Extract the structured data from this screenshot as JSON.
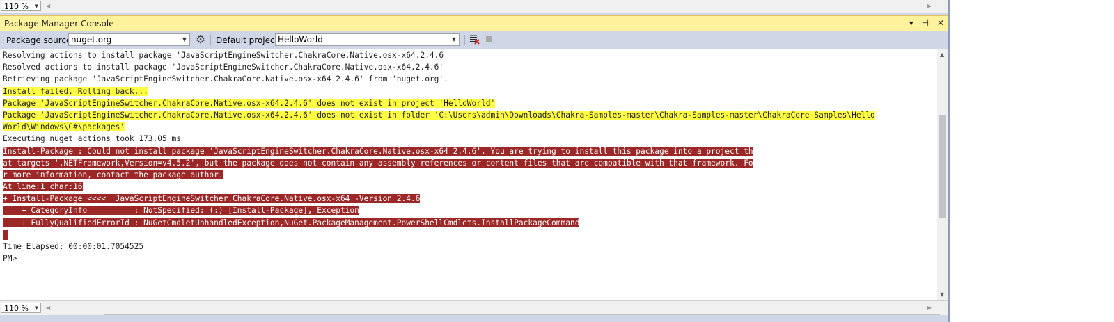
{
  "zoom_top": "110 %",
  "zoom_bottom": "110 %",
  "window": {
    "title": "Package Manager Console",
    "buttons": [
      "▾",
      "⊣",
      "✕"
    ]
  },
  "toolbar": {
    "package_source_label": "Package source:",
    "package_source_value": "nuget.org",
    "default_project_label": "Default project:",
    "default_project_value": "HelloWorld"
  },
  "console": {
    "lines": [
      {
        "text": "Resolving actions to install package 'JavaScriptEngineSwitcher.ChakraCore.Native.osx-x64.2.4.6'",
        "style": "normal"
      },
      {
        "text": "Resolved actions to install package 'JavaScriptEngineSwitcher.ChakraCore.Native.osx-x64.2.4.6'",
        "style": "normal"
      },
      {
        "text": "Retrieving package 'JavaScriptEngineSwitcher.ChakraCore.Native.osx-x64 2.4.6' from 'nuget.org'.",
        "style": "normal"
      },
      {
        "text": "Install failed. Rolling back...",
        "style": "warn"
      },
      {
        "text": "Package 'JavaScriptEngineSwitcher.ChakraCore.Native.osx-x64.2.4.6' does not exist in project 'HelloWorld'",
        "style": "warn"
      },
      {
        "text": "Package 'JavaScriptEngineSwitcher.ChakraCore.Native.osx-x64.2.4.6' does not exist in folder 'C:\\Users\\admin\\Downloads\\Chakra-Samples-master\\Chakra-Samples-master\\ChakraCore Samples\\Hello",
        "style": "warn"
      },
      {
        "text": "World\\Windows\\C#\\packages'",
        "style": "warn"
      },
      {
        "text": "Executing nuget actions took 173.05 ms",
        "style": "normal"
      },
      {
        "text": "Install-Package : Could not install package 'JavaScriptEngineSwitcher.ChakraCore.Native.osx-x64 2.4.6'. You are trying to install this package into a project th",
        "style": "err"
      },
      {
        "text": "at targets '.NETFramework,Version=v4.5.2', but the package does not contain any assembly references or content files that are compatible with that framework. Fo",
        "style": "err"
      },
      {
        "text": "r more information, contact the package author.",
        "style": "err"
      },
      {
        "text": "At line:1 char:16",
        "style": "err"
      },
      {
        "text": "+ Install-Package <<<<  JavaScriptEngineSwitcher.ChakraCore.Native.osx-x64 -Version 2.4.6",
        "style": "err"
      },
      {
        "text": "    + CategoryInfo          : NotSpecified: (:) [Install-Package], Exception",
        "style": "err"
      },
      {
        "text": "    + FullyQualifiedErrorId : NuGetCmdletUnhandledException,NuGet.PackageManagement.PowerShellCmdlets.InstallPackageCommand",
        "style": "err"
      },
      {
        "text": "",
        "style": "cursor"
      },
      {
        "text": "Time Elapsed: 00:00:01.7054525",
        "style": "normal"
      },
      {
        "text": "PM>",
        "style": "normal"
      }
    ]
  },
  "colors": {
    "warning_background": "#ffff44",
    "error_background": "#9b2727",
    "title_background": "#fff29d"
  },
  "icons": {
    "settings": "gear-icon",
    "clear": "clear-console-icon",
    "stop": "stop-icon"
  }
}
